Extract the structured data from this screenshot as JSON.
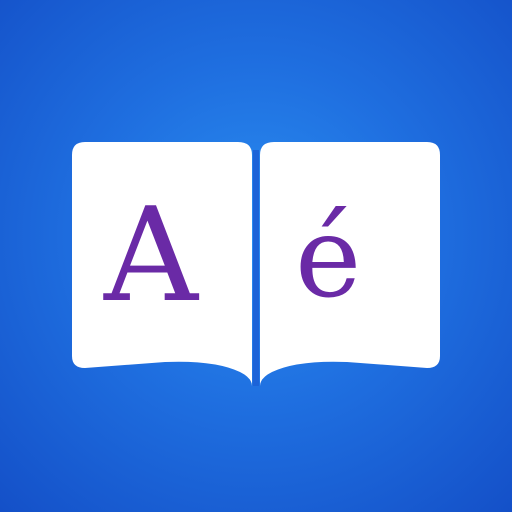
{
  "app_icon": {
    "left_letter": "A",
    "right_letter": "é",
    "background_colors": [
      "#2a8df0",
      "#1f6fe0",
      "#1450c8"
    ],
    "page_color": "#ffffff",
    "letter_color": "#6a2aa6",
    "icon_name": "open-book-icon"
  }
}
